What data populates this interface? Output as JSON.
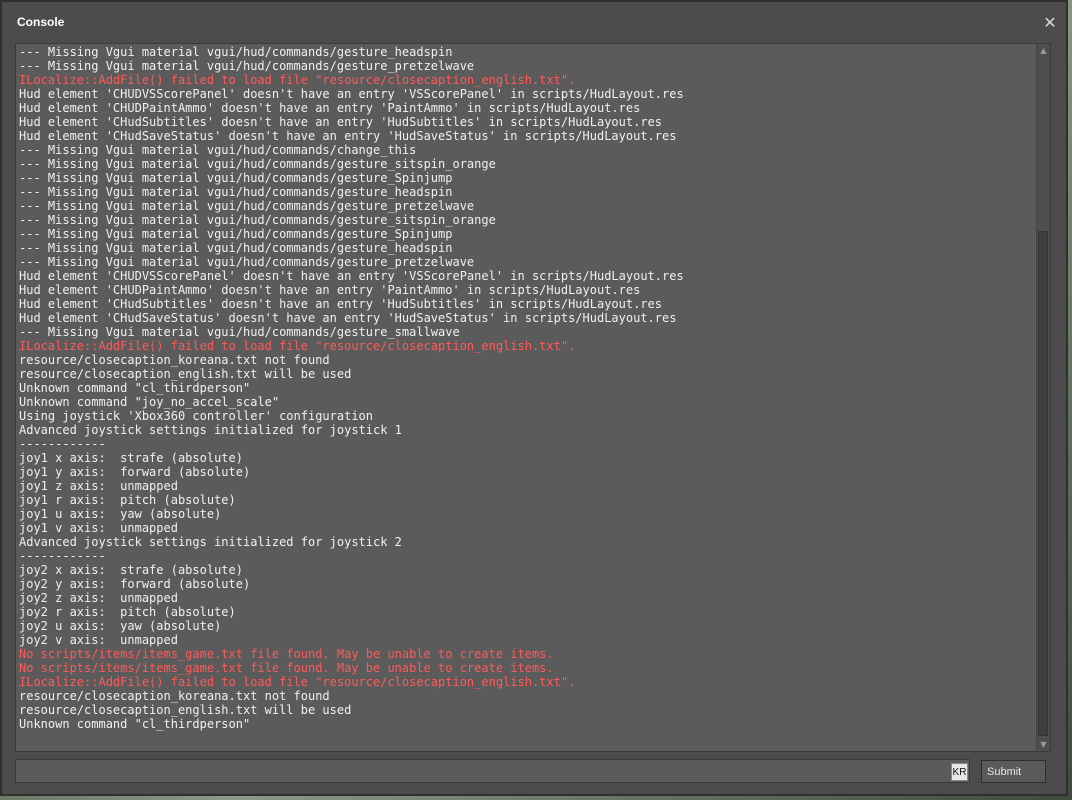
{
  "window": {
    "title": "Console",
    "close_glyph": "✕"
  },
  "colors": {
    "window_bg": "#4c4c4c",
    "panel_bg": "#5b5b5b",
    "text_normal": "#f0f0f0",
    "text_error": "#ff5a5a"
  },
  "output": {
    "lines": [
      {
        "text": "--- Missing Vgui material vgui/hud/commands/gesture_headspin",
        "type": "normal"
      },
      {
        "text": "--- Missing Vgui material vgui/hud/commands/gesture_pretzelwave",
        "type": "normal"
      },
      {
        "text": "ILocalize::AddFile() failed to load file \"resource/closecaption_english.txt\".",
        "type": "error"
      },
      {
        "text": "Hud element 'CHUDVSScorePanel' doesn't have an entry 'VSScorePanel' in scripts/HudLayout.res",
        "type": "normal"
      },
      {
        "text": "Hud element 'CHUDPaintAmmo' doesn't have an entry 'PaintAmmo' in scripts/HudLayout.res",
        "type": "normal"
      },
      {
        "text": "Hud element 'CHudSubtitles' doesn't have an entry 'HudSubtitles' in scripts/HudLayout.res",
        "type": "normal"
      },
      {
        "text": "Hud element 'CHudSaveStatus' doesn't have an entry 'HudSaveStatus' in scripts/HudLayout.res",
        "type": "normal"
      },
      {
        "text": "--- Missing Vgui material vgui/hud/commands/change_this",
        "type": "normal"
      },
      {
        "text": "--- Missing Vgui material vgui/hud/commands/gesture_sitspin_orange",
        "type": "normal"
      },
      {
        "text": "--- Missing Vgui material vgui/hud/commands/gesture_Spinjump",
        "type": "normal"
      },
      {
        "text": "--- Missing Vgui material vgui/hud/commands/gesture_headspin",
        "type": "normal"
      },
      {
        "text": "--- Missing Vgui material vgui/hud/commands/gesture_pretzelwave",
        "type": "normal"
      },
      {
        "text": "--- Missing Vgui material vgui/hud/commands/gesture_sitspin_orange",
        "type": "normal"
      },
      {
        "text": "--- Missing Vgui material vgui/hud/commands/gesture_Spinjump",
        "type": "normal"
      },
      {
        "text": "--- Missing Vgui material vgui/hud/commands/gesture_headspin",
        "type": "normal"
      },
      {
        "text": "--- Missing Vgui material vgui/hud/commands/gesture_pretzelwave",
        "type": "normal"
      },
      {
        "text": "Hud element 'CHUDVSScorePanel' doesn't have an entry 'VSScorePanel' in scripts/HudLayout.res",
        "type": "normal"
      },
      {
        "text": "Hud element 'CHUDPaintAmmo' doesn't have an entry 'PaintAmmo' in scripts/HudLayout.res",
        "type": "normal"
      },
      {
        "text": "Hud element 'CHudSubtitles' doesn't have an entry 'HudSubtitles' in scripts/HudLayout.res",
        "type": "normal"
      },
      {
        "text": "Hud element 'CHudSaveStatus' doesn't have an entry 'HudSaveStatus' in scripts/HudLayout.res",
        "type": "normal"
      },
      {
        "text": "--- Missing Vgui material vgui/hud/commands/gesture_smallwave",
        "type": "normal"
      },
      {
        "text": "ILocalize::AddFile() failed to load file \"resource/closecaption_english.txt\".",
        "type": "error"
      },
      {
        "text": "resource/closecaption_koreana.txt not found",
        "type": "normal"
      },
      {
        "text": "resource/closecaption_english.txt will be used",
        "type": "normal"
      },
      {
        "text": "Unknown command \"cl_thirdperson\"",
        "type": "normal"
      },
      {
        "text": "Unknown command \"joy_no_accel_scale\"",
        "type": "normal"
      },
      {
        "text": "Using joystick 'Xbox360 controller' configuration",
        "type": "normal"
      },
      {
        "text": "Advanced joystick settings initialized for joystick 1",
        "type": "normal"
      },
      {
        "text": "------------",
        "type": "normal"
      },
      {
        "text": "joy1 x axis:  strafe (absolute)",
        "type": "normal"
      },
      {
        "text": "joy1 y axis:  forward (absolute)",
        "type": "normal"
      },
      {
        "text": "joy1 z axis:  unmapped",
        "type": "normal"
      },
      {
        "text": "joy1 r axis:  pitch (absolute)",
        "type": "normal"
      },
      {
        "text": "joy1 u axis:  yaw (absolute)",
        "type": "normal"
      },
      {
        "text": "joy1 v axis:  unmapped",
        "type": "normal"
      },
      {
        "text": "Advanced joystick settings initialized for joystick 2",
        "type": "normal"
      },
      {
        "text": "------------",
        "type": "normal"
      },
      {
        "text": "joy2 x axis:  strafe (absolute)",
        "type": "normal"
      },
      {
        "text": "joy2 y axis:  forward (absolute)",
        "type": "normal"
      },
      {
        "text": "joy2 z axis:  unmapped",
        "type": "normal"
      },
      {
        "text": "joy2 r axis:  pitch (absolute)",
        "type": "normal"
      },
      {
        "text": "joy2 u axis:  yaw (absolute)",
        "type": "normal"
      },
      {
        "text": "joy2 v axis:  unmapped",
        "type": "normal"
      },
      {
        "text": "No scripts/items/items_game.txt file found. May be unable to create items.",
        "type": "error"
      },
      {
        "text": "No scripts/items/items_game.txt file found. May be unable to create items.",
        "type": "error"
      },
      {
        "text": "ILocalize::AddFile() failed to load file \"resource/closecaption_english.txt\".",
        "type": "error"
      },
      {
        "text": "resource/closecaption_koreana.txt not found",
        "type": "normal"
      },
      {
        "text": "resource/closecaption_english.txt will be used",
        "type": "normal"
      },
      {
        "text": "Unknown command \"cl_thirdperson\"",
        "type": "normal"
      }
    ]
  },
  "scrollbar": {
    "up_glyph": "▲",
    "down_glyph": "▼"
  },
  "input": {
    "value": "",
    "ime_indicator": "KR"
  },
  "submit": {
    "label": "Submit"
  }
}
